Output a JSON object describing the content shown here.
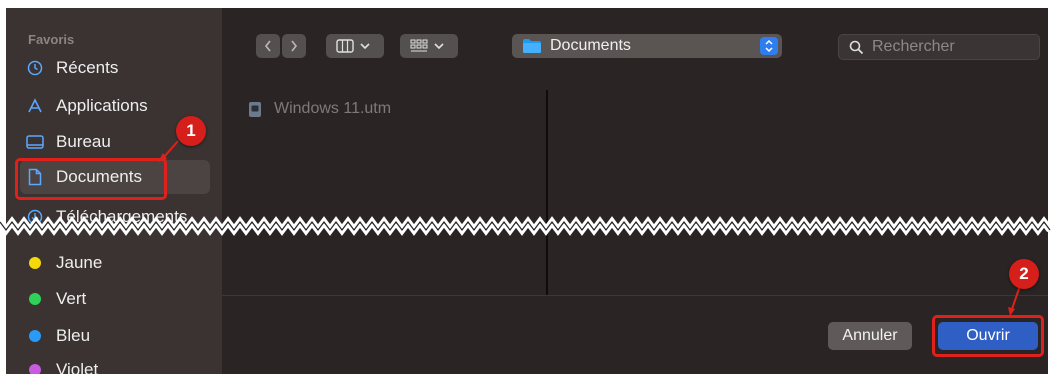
{
  "sidebar": {
    "section_title": "Favoris",
    "items": [
      {
        "label": "Récents",
        "icon": "clock-icon"
      },
      {
        "label": "Applications",
        "icon": "applications-icon"
      },
      {
        "label": "Bureau",
        "icon": "desktop-icon"
      },
      {
        "label": "Documents",
        "icon": "document-icon",
        "selected": true
      },
      {
        "label": "Téléchargements",
        "icon": "download-icon"
      }
    ],
    "tags": [
      {
        "label": "Jaune",
        "color": "#f5d90a"
      },
      {
        "label": "Vert",
        "color": "#2fd158"
      },
      {
        "label": "Bleu",
        "color": "#2a9af7"
      },
      {
        "label": "Violet",
        "color": "#c85be0"
      }
    ]
  },
  "toolbar": {
    "location": "Documents",
    "search_placeholder": "Rechercher"
  },
  "files": [
    {
      "name": "Windows 11.utm",
      "icon": "utm-file-icon"
    }
  ],
  "actions": {
    "cancel_label": "Annuler",
    "open_label": "Ouvrir"
  },
  "annotations": {
    "step1": "1",
    "step2": "2"
  },
  "colors": {
    "accent": "#2f5fc4",
    "annotation_red": "#e0201b",
    "folder_blue": "#1e9bf0"
  }
}
